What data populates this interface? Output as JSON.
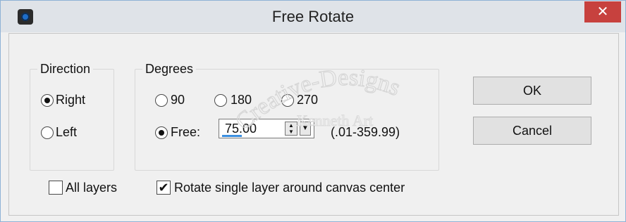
{
  "window": {
    "title": "Free Rotate",
    "close_glyph": "✕"
  },
  "direction": {
    "group_label": "Direction",
    "options": [
      {
        "label": "Right",
        "selected": true
      },
      {
        "label": "Left",
        "selected": false
      }
    ]
  },
  "degrees": {
    "group_label": "Degrees",
    "presets": [
      {
        "label": "90",
        "selected": false
      },
      {
        "label": "180",
        "selected": false
      },
      {
        "label": "270",
        "selected": false
      }
    ],
    "free": {
      "label": "Free:",
      "selected": true,
      "value": "75.00",
      "range_hint": "(.01-359.99)"
    }
  },
  "buttons": {
    "ok": "OK",
    "cancel": "Cancel"
  },
  "options": {
    "all_layers": {
      "label": "All layers",
      "checked": false
    },
    "rotate_single": {
      "label": "Rotate single layer around canvas center",
      "checked": true,
      "check_glyph": "✔"
    }
  },
  "watermark": {
    "line1": "Creative-Designs",
    "line2": "Kenneth Art"
  },
  "colors": {
    "close": "#c7413e",
    "accent": "#3b8fe0"
  },
  "icons": {
    "app": "camera-lens-icon",
    "spin": "spin-arrows-icon",
    "dropdown": "dropdown-arrow-icon"
  }
}
